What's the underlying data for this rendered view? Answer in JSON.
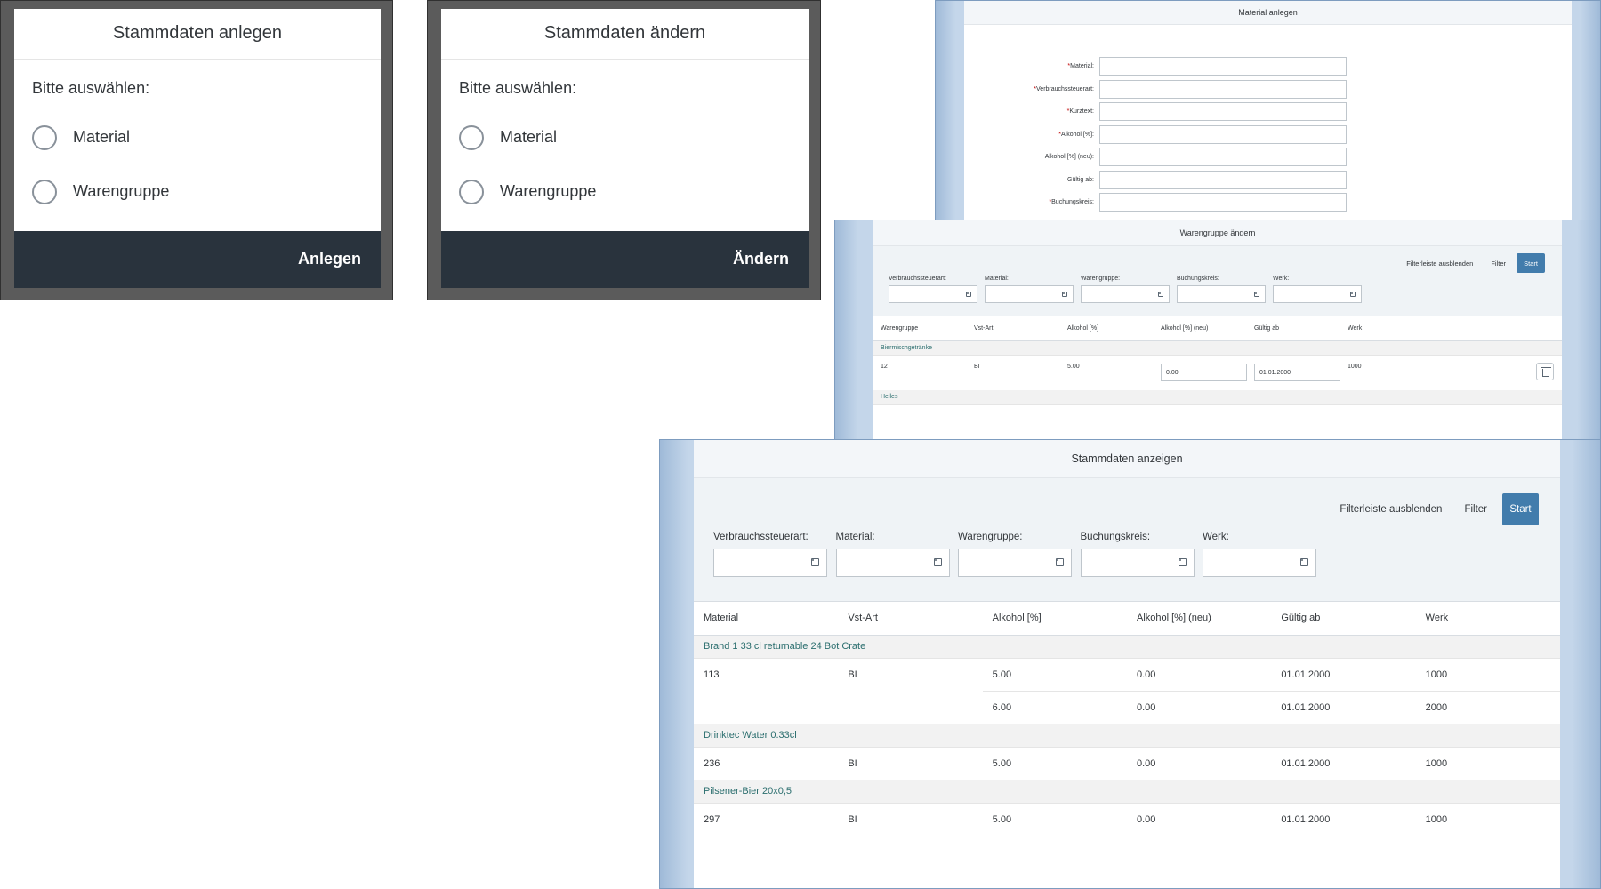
{
  "dialog_create": {
    "title": "Stammdaten anlegen",
    "prompt": "Bitte auswählen:",
    "options": [
      "Material",
      "Warengruppe"
    ],
    "action": "Anlegen"
  },
  "dialog_change": {
    "title": "Stammdaten ändern",
    "prompt": "Bitte auswählen:",
    "options": [
      "Material",
      "Warengruppe"
    ],
    "action": "Ändern"
  },
  "material_create": {
    "title": "Material anlegen",
    "fields": [
      {
        "label": "Material:",
        "required": "*"
      },
      {
        "label": "Verbrauchssteuerart:",
        "required": "*"
      },
      {
        "label": "Kurztext:",
        "required": "*"
      },
      {
        "label": "Alkohol [%]:",
        "required": "*"
      },
      {
        "label": "Alkohol [%] (neu):",
        "required": ""
      },
      {
        "label": "Gültig ab:",
        "required": ""
      },
      {
        "label": "Buchungskreis:",
        "required": "*"
      }
    ]
  },
  "group_change": {
    "title": "Warengruppe ändern",
    "hide_filterbar": "Filterleiste ausblenden",
    "filter": "Filter",
    "start": "Start",
    "filters": [
      "Verbrauchssteuerart:",
      "Material:",
      "Warengruppe:",
      "Buchungskreis:",
      "Werk:"
    ],
    "columns": [
      "Warengruppe",
      "Vst-Art",
      "Alkohol [%]",
      "Alkohol [%] (neu)",
      "Gültig ab",
      "Werk"
    ],
    "groups": [
      {
        "name": "Biermischgetränke",
        "rows": [
          {
            "id": "12",
            "vst": "BI",
            "alk": "5.00",
            "alk_new": "0.00",
            "valid": "01.01.2000",
            "werk": "1000"
          }
        ]
      },
      {
        "name": "Helles",
        "rows": []
      }
    ]
  },
  "display": {
    "title": "Stammdaten anzeigen",
    "hide_filterbar": "Filterleiste ausblenden",
    "filter": "Filter",
    "start": "Start",
    "filters": [
      "Verbrauchssteuerart:",
      "Material:",
      "Warengruppe:",
      "Buchungskreis:",
      "Werk:"
    ],
    "columns": [
      "Material",
      "Vst-Art",
      "Alkohol [%]",
      "Alkohol [%] (neu)",
      "Gültig ab",
      "Werk"
    ],
    "groups": [
      {
        "name": "Brand 1 33 cl returnable 24 Bot Crate",
        "rows": [
          {
            "id": "113",
            "vst": "BI",
            "alk": "5.00",
            "alk_new": "0.00",
            "valid": "01.01.2000",
            "werk": "1000"
          },
          {
            "id": "",
            "vst": "",
            "alk": "6.00",
            "alk_new": "0.00",
            "valid": "01.01.2000",
            "werk": "2000"
          }
        ]
      },
      {
        "name": "Drinktec Water 0.33cl",
        "rows": [
          {
            "id": "236",
            "vst": "BI",
            "alk": "5.00",
            "alk_new": "0.00",
            "valid": "01.01.2000",
            "werk": "1000"
          }
        ]
      },
      {
        "name": "Pilsener-Bier 20x0,5",
        "rows": [
          {
            "id": "297",
            "vst": "BI",
            "alk": "5.00",
            "alk_new": "0.00",
            "valid": "01.01.2000",
            "werk": "1000"
          }
        ]
      }
    ]
  }
}
